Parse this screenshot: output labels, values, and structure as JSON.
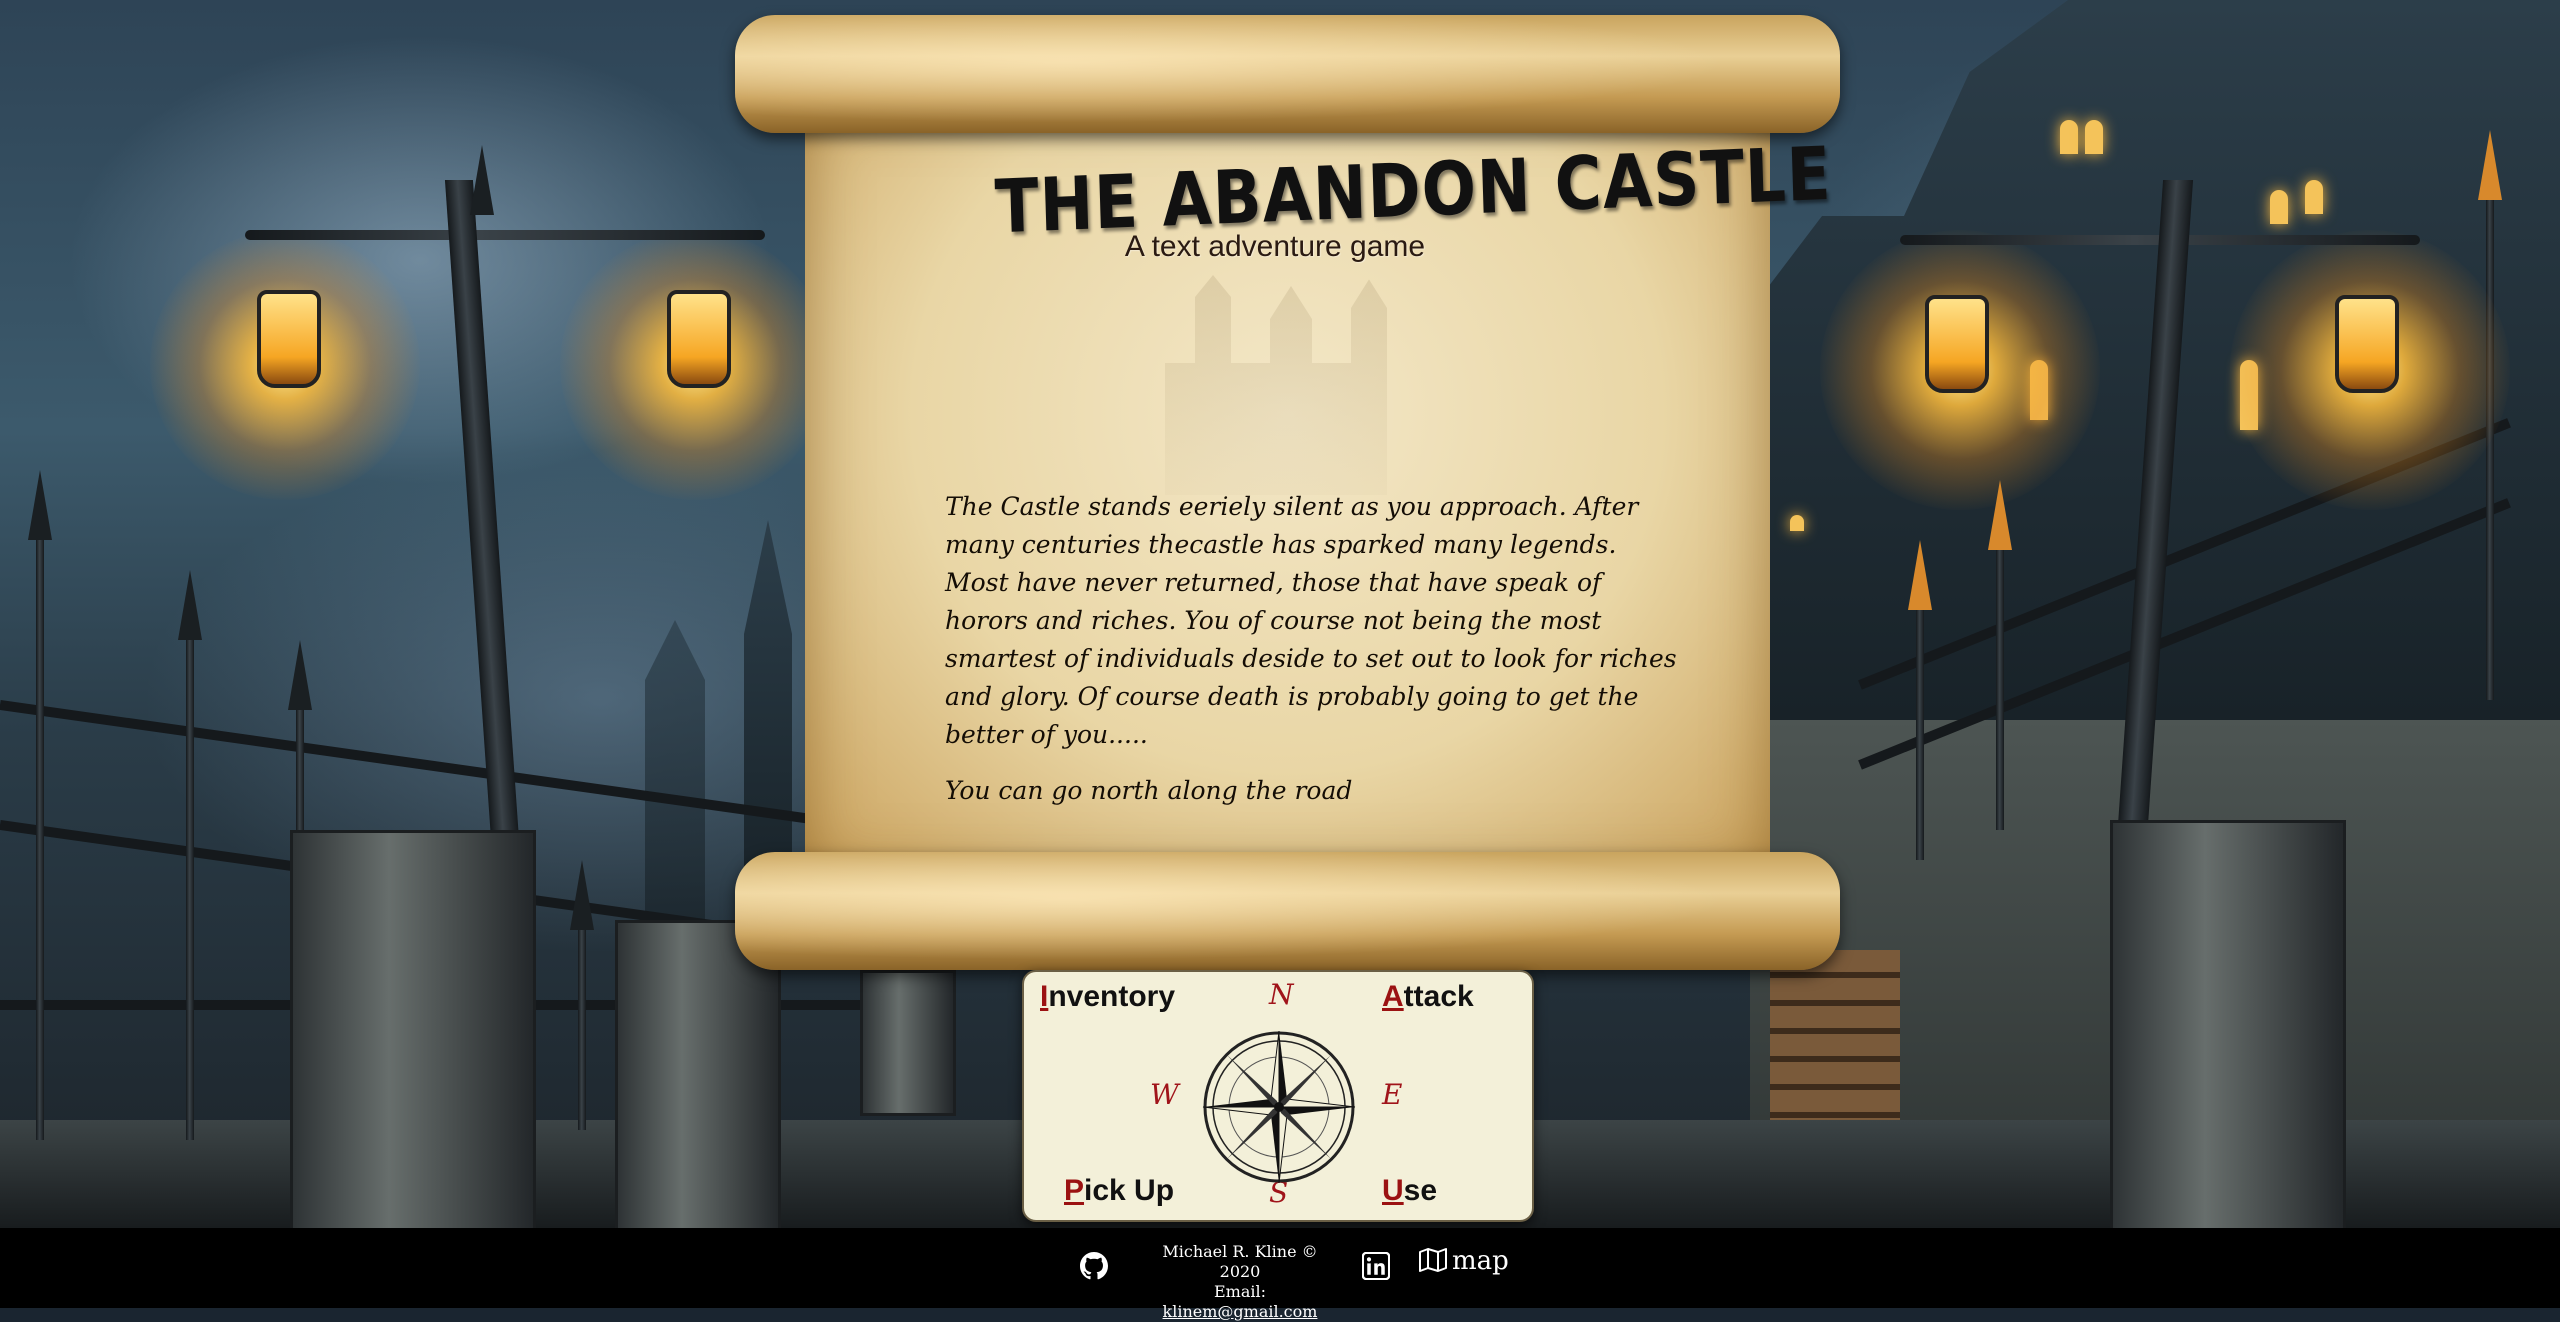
{
  "game": {
    "title": "THE ABANDON CASTLE",
    "subtitle": "A text adventure game"
  },
  "story": {
    "intro": "The Castle stands eeriely silent as you approach. After many centuries thecastle has sparked many legends. Most have never returned, those that have speak of horors and riches. You of course not being the most smartest of individuals deside to set out to look for riches and glory. Of course death is probably going to get the better of you.....",
    "exits": "You can go north along the road"
  },
  "controls": {
    "inventory": {
      "key": "I",
      "rest": "nventory"
    },
    "attack": {
      "key": "A",
      "rest": "ttack"
    },
    "pickup": {
      "key": "P",
      "rest": "ick Up"
    },
    "use": {
      "key": "U",
      "rest": "se"
    },
    "directions": {
      "north": "N",
      "south": "S",
      "east": "E",
      "west": "W"
    }
  },
  "footer": {
    "credit": "Michael R. Kline © 2020",
    "email_label": "Email:",
    "email": "klinem@gmail.com",
    "map_label": "map",
    "icons": [
      "github-icon",
      "linkedin-icon",
      "map-icon"
    ]
  },
  "colors": {
    "accent_red": "#9b1212",
    "panel_bg": "#f3f0d9",
    "footer_bg": "#000000"
  }
}
